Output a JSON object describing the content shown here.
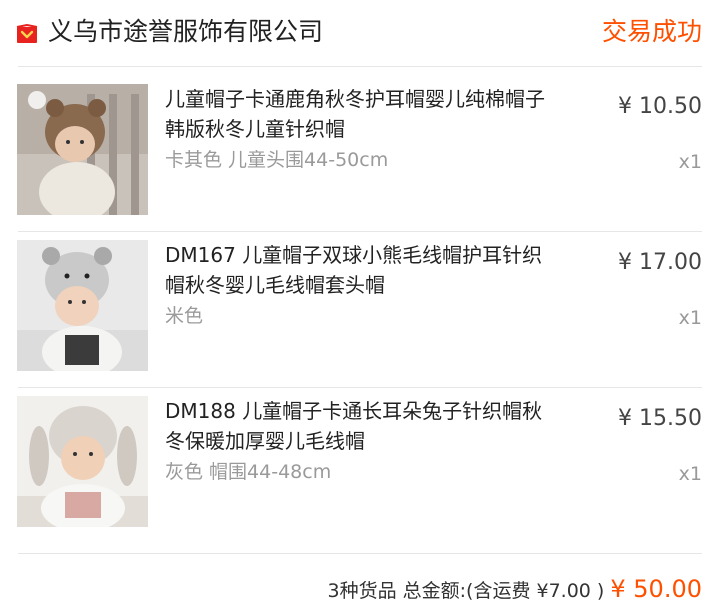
{
  "shop": {
    "name": "义乌市途誉服饰有限公司",
    "status": "交易成功",
    "icon": "shop-icon",
    "accent_color": "#ff5000"
  },
  "items": [
    {
      "title": "儿童帽子卡通鹿角秋冬护耳帽婴儿纯棉帽子韩版秋冬儿童针织帽",
      "sku": "卡其色 儿童头围44-50cm",
      "price": "¥ 10.50",
      "qty": "x1"
    },
    {
      "title": "DM167 儿童帽子双球小熊毛线帽护耳针织帽秋冬婴儿毛线帽套头帽",
      "sku": "米色",
      "price": "¥ 17.00",
      "qty": "x1"
    },
    {
      "title": "DM188 儿童帽子卡通长耳朵兔子针织帽秋冬保暖加厚婴儿毛线帽",
      "sku": "灰色 帽围44-48cm",
      "price": "¥ 15.50",
      "qty": "x1"
    }
  ],
  "summary": {
    "count_label": "3种货品",
    "total_label": "总金额:",
    "shipping_label": "(含运费 ¥7.00 )",
    "total_amount": "¥ 50.00"
  }
}
